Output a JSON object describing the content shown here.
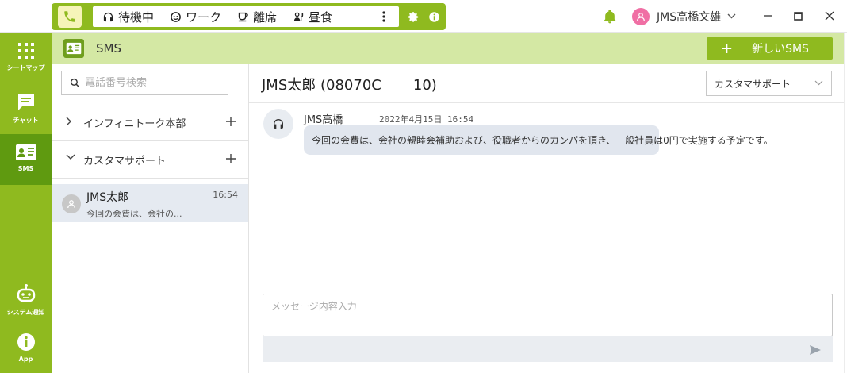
{
  "statusbar": {
    "items": [
      {
        "label": "待機中",
        "icon": "headset-icon"
      },
      {
        "label": "ワーク",
        "icon": "face-icon"
      },
      {
        "label": "離席",
        "icon": "cup-icon"
      },
      {
        "label": "昼食",
        "icon": "meal-icon"
      }
    ],
    "more_icon": "more-vertical-icon",
    "settings_icon": "gear-icon",
    "info_icon": "info-icon"
  },
  "titlebar": {
    "user_name": "JMS高橋文雄",
    "bell_icon": "bell-icon"
  },
  "nav": [
    {
      "label": "シートマップ",
      "icon": "grid-icon"
    },
    {
      "label": "チャット",
      "icon": "chat-icon"
    },
    {
      "label": "SMS",
      "icon": "sms-icon"
    },
    {
      "label": "システム通知",
      "icon": "robot-icon"
    },
    {
      "label": "App",
      "icon": "info-icon"
    }
  ],
  "header": {
    "title": "SMS",
    "new_sms_label": "新しいSMS",
    "new_sms_plus": "+"
  },
  "left_panel": {
    "search_placeholder": "電話番号検索",
    "groups": [
      {
        "name": "インフィニトーク本部",
        "expanded": false
      },
      {
        "name": "カスタマサポート",
        "expanded": true
      }
    ],
    "contact": {
      "name": "JMS太郎",
      "time": "16:54",
      "preview": "今回の会費は、会社の..."
    }
  },
  "conversation": {
    "title": "JMS太郎 (08070C       10)",
    "department": "カスタマサポート",
    "message": {
      "sender": "JMS高橋",
      "timestamp": "2022年4月15日 16:54",
      "text": "今回の会費は、会社の親睦会補助および、役職者からのカンパを頂き、一般社員は0円で実施する予定です。"
    },
    "composer_placeholder": "メッセージ内容入力"
  },
  "colors": {
    "brand_green": "#8fba1f",
    "active_green": "#5f9a10",
    "header_band": "#d4e8a4",
    "bubble": "#e1e6ee",
    "avatar_pink": "#f06fa4"
  }
}
